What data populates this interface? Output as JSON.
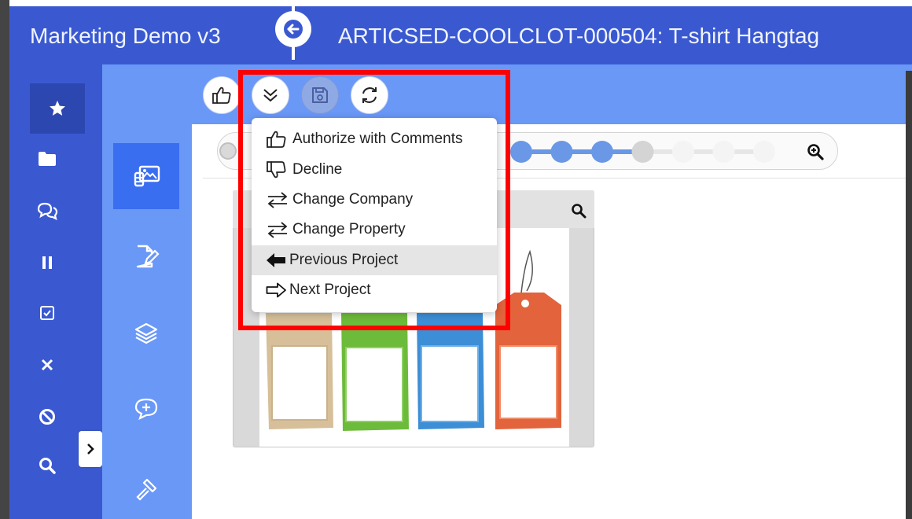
{
  "header": {
    "app_title": "Marketing Demo v3",
    "project_title": "ARTICSED-COOLCLOT-000504: T-shirt Hangtag"
  },
  "colors": {
    "header_bg": "#3a59d1",
    "subnav_bg": "#6a98f7",
    "highlight": "#ff0000"
  },
  "leftnav": {
    "icons": [
      "star-icon",
      "folder-icon",
      "comments-icon",
      "pause-icon",
      "checkbox-icon",
      "close-icon",
      "ban-icon",
      "search-icon"
    ]
  },
  "subnav": {
    "icons": [
      "images-icon",
      "file-edit-icon",
      "layers-icon",
      "comment-add-icon",
      "hammer-icon"
    ]
  },
  "toolbar": {
    "icons": [
      "thumbs-up-icon",
      "chevron-double-down-icon",
      "save-icon",
      "refresh-icon"
    ]
  },
  "workflow_progress": {
    "completed_steps": 3,
    "current_step": 4,
    "total_steps": 7
  },
  "dropdown": {
    "items": [
      {
        "label": "Authorize with Comments",
        "icon": "thumbs-up-icon"
      },
      {
        "label": "Decline",
        "icon": "thumbs-down-icon"
      },
      {
        "label": "Change Company",
        "icon": "swap-icon"
      },
      {
        "label": "Change Property",
        "icon": "swap-icon"
      },
      {
        "label": "Previous Project",
        "icon": "arrow-left-icon"
      },
      {
        "label": "Next Project",
        "icon": "arrow-right-icon"
      }
    ]
  }
}
